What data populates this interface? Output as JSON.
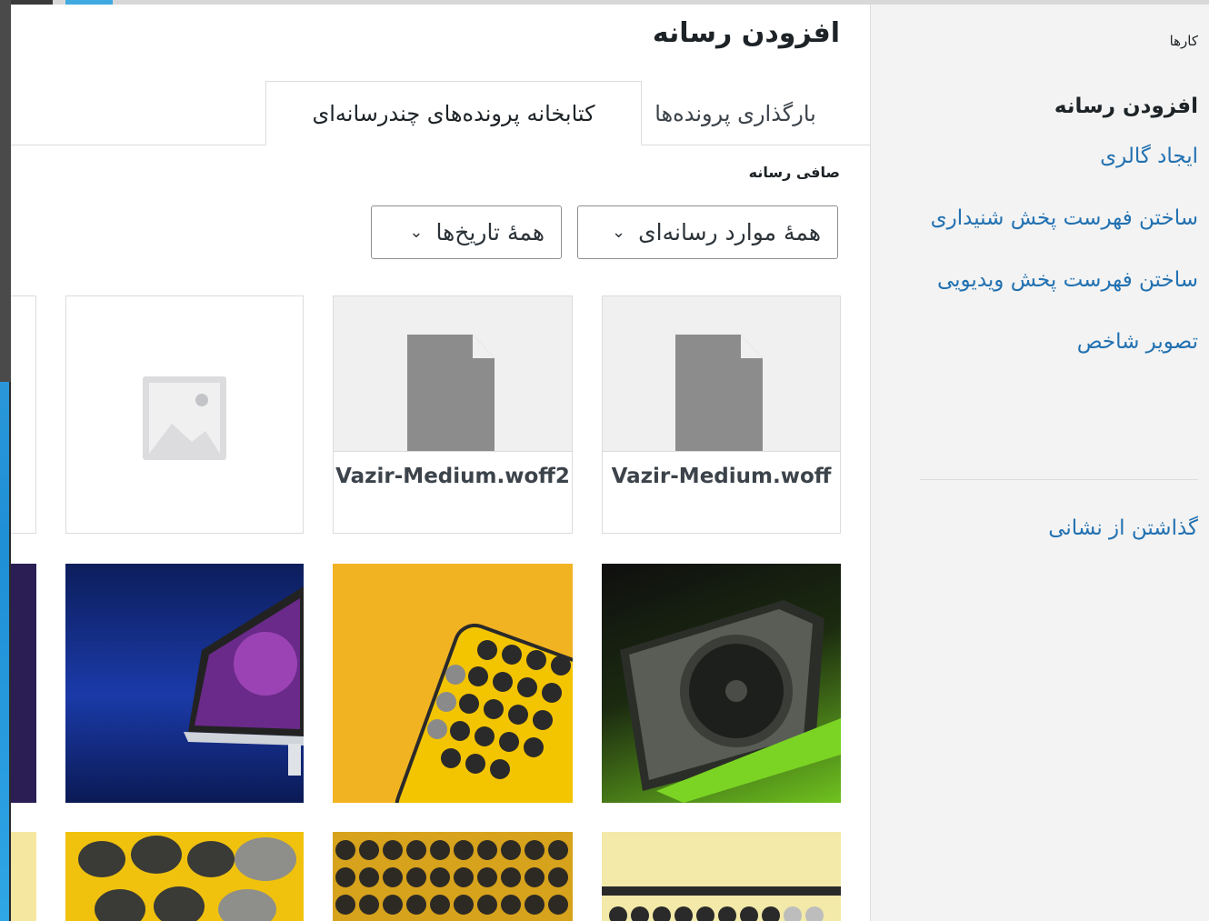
{
  "sidebar": {
    "heading": "کارها",
    "items": [
      {
        "label": "افزودن رسانه",
        "active": true
      },
      {
        "label": "ایجاد گالری",
        "active": false
      },
      {
        "label": "ساختن فهرست پخش شنیداری",
        "active": false
      },
      {
        "label": "ساختن فهرست پخش ویدیویی",
        "active": false
      },
      {
        "label": "تصویر شاخص",
        "active": false
      }
    ],
    "unset_label": "گذاشتن از نشانی"
  },
  "main": {
    "title": "افزودن رسانه",
    "tabs": [
      {
        "label": "بارگذاری پرونده‌ها",
        "active": false
      },
      {
        "label": "کتابخانه پرونده‌های چندرسانه‌ای",
        "active": true
      }
    ],
    "filter": {
      "label": "صافی رسانه",
      "type_selected": "همهٔ موارد رسانه‌ای",
      "date_selected": "همهٔ تاریخ‌ها"
    }
  },
  "attachments": [
    {
      "kind": "file",
      "filename": "Vazir-Medium.woff",
      "icon": "document-icon"
    },
    {
      "kind": "file",
      "filename": "Vazir-Medium.woff2",
      "icon": "document-icon"
    },
    {
      "kind": "placeholder",
      "icon": "image-placeholder-icon"
    },
    {
      "kind": "image",
      "subject": "graphics-card"
    },
    {
      "kind": "image",
      "subject": "yellow-keyboard"
    },
    {
      "kind": "image",
      "subject": "monitor"
    },
    {
      "kind": "image",
      "subject": "keyboard-closeup"
    },
    {
      "kind": "image",
      "subject": "keyboard-keys"
    },
    {
      "kind": "image",
      "subject": "keyboard-round-keys"
    }
  ],
  "colors": {
    "link": "#2271b1",
    "text": "#1d2327",
    "border": "#dcdcde"
  }
}
